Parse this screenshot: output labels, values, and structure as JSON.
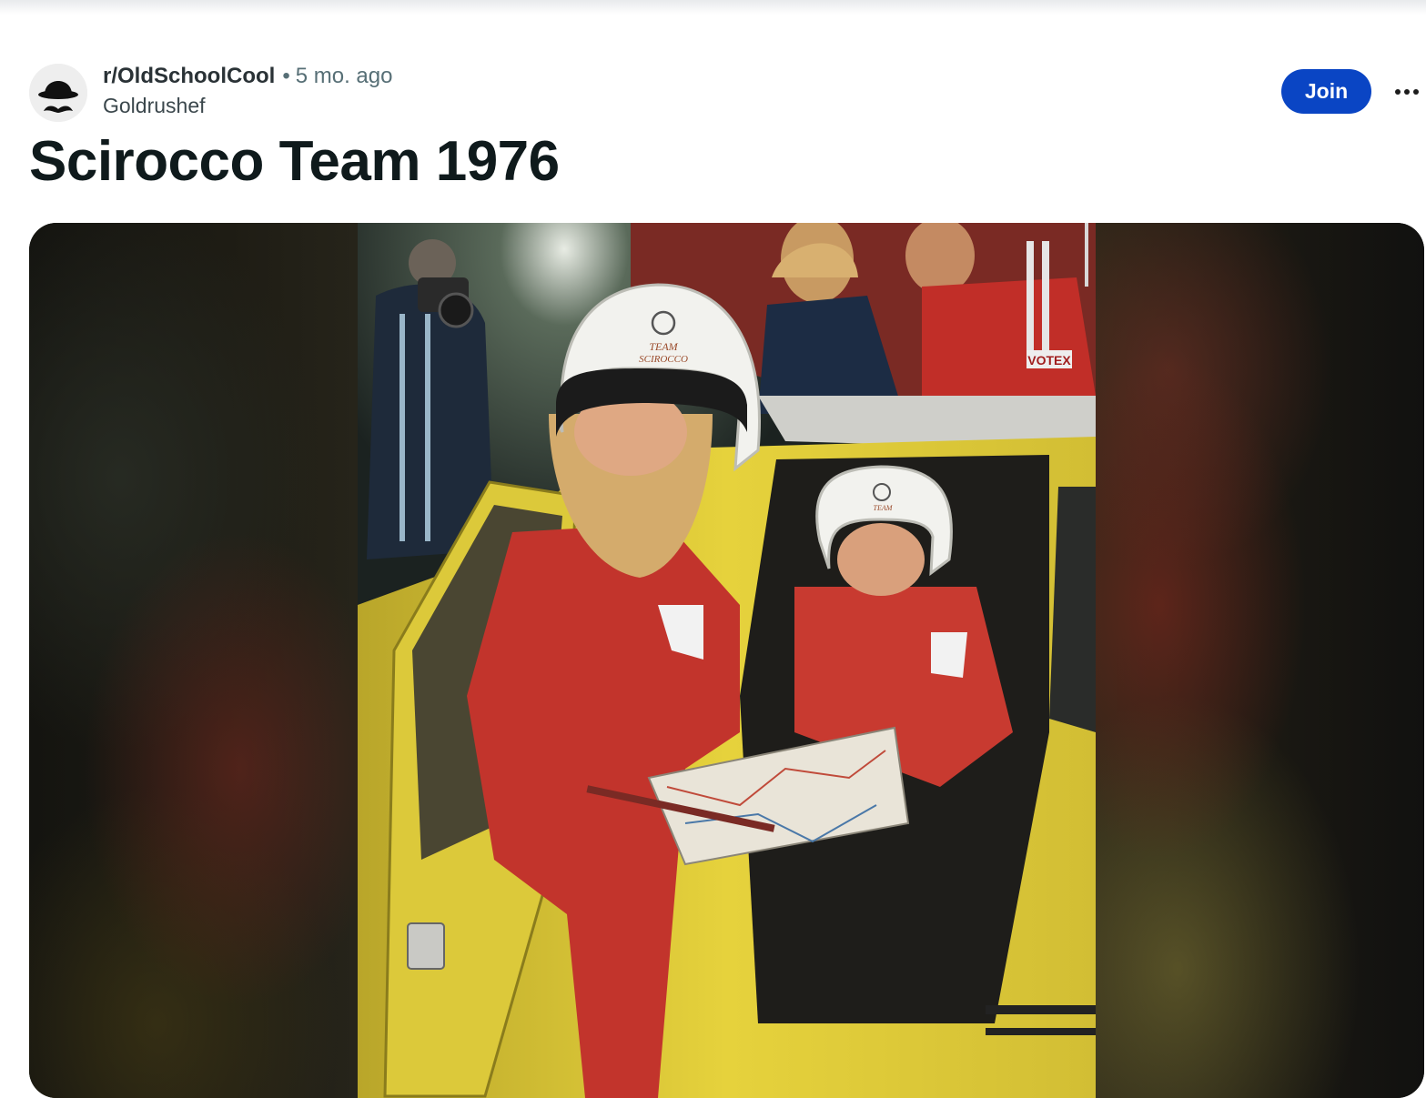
{
  "post": {
    "subreddit": "r/OldSchoolCool",
    "separator": "•",
    "timestamp": "5 mo. ago",
    "author": "Goldrushef",
    "title": "Scirocco Team 1976",
    "join_label": "Join",
    "more_icon": "more-horizontal-icon",
    "avatar_icon": "bowler-hat-mustache-icon"
  },
  "media": {
    "helmet_text_line1": "TEAM",
    "helmet_text_line2": "SCIROCCO",
    "patch_text": "VOTEX"
  },
  "colors": {
    "join_button": "#0a45c4",
    "car_yellow": "#e3cf38",
    "suit_red": "#c2342c",
    "helmet_white": "#f2f2ee"
  }
}
